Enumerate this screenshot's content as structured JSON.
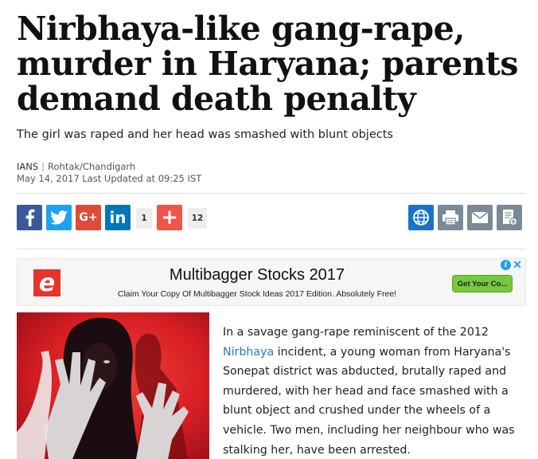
{
  "article": {
    "headline": "Nirbhaya-like gang-rape, murder in Haryana; parents demand death penalty",
    "subhead": "The girl was raped and her head was smashed with blunt objects",
    "author": "IANS",
    "separator": "|",
    "location": "Rohtak/Chandigarh",
    "date": "May 14, 2017 Last Updated at 09:25 IST",
    "body_before_link": "In a savage gang-rape reminiscent of the 2012 ",
    "body_link": "Nirbhaya",
    "body_after_link": " incident, a young woman from Haryana's Sonepat district was abducted, brutally raped and murdered, with her head and face smashed with a blunt object and crushed under the wheels of a vehicle. Two men, including her neighbour who was stalking her, have been arrested."
  },
  "share": {
    "facebook_icon": "facebook-icon",
    "twitter_icon": "twitter-icon",
    "googleplus_label": "G+",
    "linkedin_label": "in",
    "linkedin_count": "1",
    "plus_label": "+",
    "plus_count": "12",
    "colors": {
      "facebook": "#3b5998",
      "twitter": "#1da1f2",
      "googleplus": "#dd4b39",
      "linkedin": "#0077b5",
      "plus": "#f0554a",
      "translate": "#1a73c9",
      "tools": "#7a8a96"
    }
  },
  "tools": [
    "translate-icon",
    "print-icon",
    "email-icon",
    "add-note-icon"
  ],
  "ad": {
    "logo_letter": "e",
    "title": "Multibagger Stocks 2017",
    "text": "Claim Your Copy Of Multibagger Stock Ideas 2017 Edition. Absolutely Free!",
    "cta": "Get Your Co...",
    "info": "i",
    "close": "✕"
  }
}
